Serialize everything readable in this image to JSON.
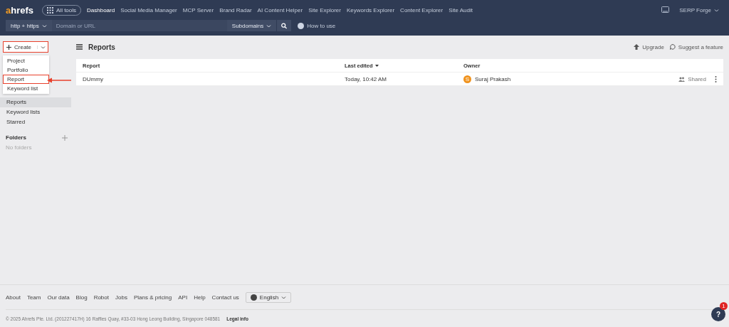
{
  "header": {
    "logo": {
      "accent": "a",
      "rest": "hrefs"
    },
    "all_tools": "All tools",
    "nav": [
      {
        "label": "Dashboard",
        "selected": true
      },
      {
        "label": "Social Media Manager",
        "selected": false
      },
      {
        "label": "MCP Server",
        "selected": false
      },
      {
        "label": "Brand Radar",
        "selected": false
      },
      {
        "label": "AI Content Helper",
        "selected": false
      },
      {
        "label": "Site Explorer",
        "selected": false
      },
      {
        "label": "Keywords Explorer",
        "selected": false
      },
      {
        "label": "Content Explorer",
        "selected": false
      },
      {
        "label": "Site Audit",
        "selected": false
      }
    ],
    "account": "SERP Forge"
  },
  "search_bar": {
    "protocol": "http + https",
    "placeholder": "Domain or URL",
    "scope": "Subdomains",
    "help": "How to use"
  },
  "sidebar": {
    "create": {
      "label": "Create",
      "annotated": true
    },
    "menu": [
      {
        "label": "Project",
        "annotated": false
      },
      {
        "label": "Portfolio",
        "annotated": false
      },
      {
        "label": "Report",
        "annotated": true
      },
      {
        "label": "Keyword list",
        "annotated": false
      }
    ],
    "items": [
      {
        "label": "Reports",
        "selected": true
      },
      {
        "label": "Keyword lists",
        "selected": false
      },
      {
        "label": "Starred",
        "selected": false
      }
    ],
    "folders_title": "Folders",
    "folders_empty": "No folders"
  },
  "page": {
    "title": "Reports",
    "actions": [
      "Upgrade",
      "Suggest a feature"
    ]
  },
  "table": {
    "columns": [
      "Report",
      "Last edited",
      "Owner"
    ],
    "rows": [
      {
        "name": "DUmmy",
        "edited": "Today, 10:42 AM",
        "owner_initial": "S",
        "owner": "Suraj Prakash",
        "sharing": "Shared"
      }
    ]
  },
  "footer": {
    "links": [
      "About",
      "Team",
      "Our data",
      "Blog",
      "Robot",
      "Jobs",
      "Plans & pricing",
      "API",
      "Help",
      "Contact us"
    ],
    "language": "English",
    "copyright": "© 2025 Ahrefs Pte. Ltd. (201227417H) 16 Raffles Quay, #33-03 Hong Leong Building, Singapore 048581",
    "legal": "Legal info"
  },
  "help_button": {
    "label": "?",
    "badge": "1"
  }
}
